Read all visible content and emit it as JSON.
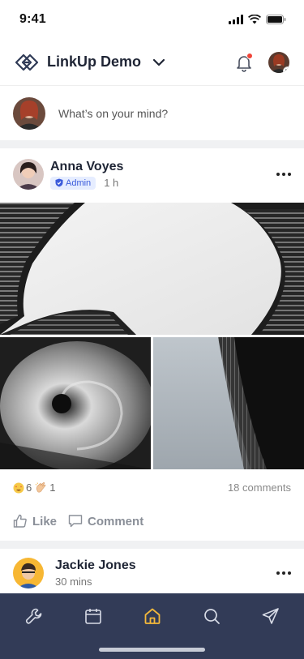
{
  "status_bar": {
    "time": "9:41"
  },
  "header": {
    "title": "LinkUp Demo",
    "accent_color": "#f04438"
  },
  "composer": {
    "placeholder": "What’s on your mind?"
  },
  "posts": [
    {
      "author": "Anna Voyes",
      "badge": "Admin",
      "time": "1 h",
      "reactions": [
        {
          "icon": "heart-eyes-emoji",
          "count": "6"
        },
        {
          "icon": "clapping-hands-emoji",
          "count": "1"
        }
      ],
      "comments": "18 comments",
      "actions": {
        "like": "Like",
        "comment": "Comment"
      }
    },
    {
      "author": "Jackie Jones",
      "time": "30 mins"
    }
  ],
  "bottom_nav": {
    "items": [
      {
        "icon": "wrench-icon",
        "active": false
      },
      {
        "icon": "calendar-icon",
        "active": false
      },
      {
        "icon": "home-icon",
        "active": true
      },
      {
        "icon": "search-icon",
        "active": false
      },
      {
        "icon": "send-icon",
        "active": false
      }
    ],
    "active_color": "#f5b93b",
    "background": "#323b57"
  }
}
